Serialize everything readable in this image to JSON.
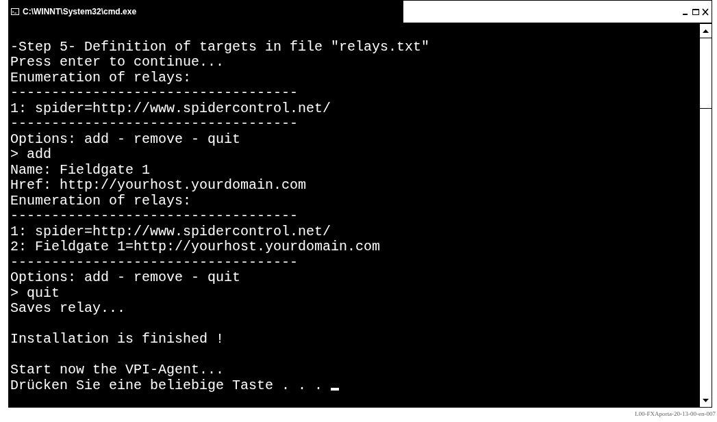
{
  "window": {
    "title": "C:\\WINNT\\System32\\cmd.exe",
    "active": true
  },
  "console_lines": [
    {
      "kind": "blank",
      "cursor": false
    },
    {
      "kind": "text",
      "text": "-Step 5- Definition of targets in file \"relays.txt\"",
      "cursor": false
    },
    {
      "kind": "text",
      "text": "Press enter to continue...",
      "cursor": false
    },
    {
      "kind": "text",
      "text": "Enumeration of relays:",
      "cursor": false
    },
    {
      "kind": "text",
      "text": "-----------------------------------",
      "cursor": false
    },
    {
      "kind": "text",
      "text": "1: spider=http://www.spidercontrol.net/",
      "cursor": false
    },
    {
      "kind": "text",
      "text": "-----------------------------------",
      "cursor": false
    },
    {
      "kind": "text",
      "text": "Options: add - remove - quit",
      "cursor": false
    },
    {
      "kind": "text",
      "text": "> add",
      "cursor": false
    },
    {
      "kind": "text",
      "text": "Name: Fieldgate 1",
      "cursor": false
    },
    {
      "kind": "text",
      "text": "Href: http://yourhost.yourdomain.com",
      "cursor": false
    },
    {
      "kind": "text",
      "text": "Enumeration of relays:",
      "cursor": false
    },
    {
      "kind": "text",
      "text": "-----------------------------------",
      "cursor": false
    },
    {
      "kind": "text",
      "text": "1: spider=http://www.spidercontrol.net/",
      "cursor": false
    },
    {
      "kind": "text",
      "text": "2: Fieldgate 1=http://yourhost.yourdomain.com",
      "cursor": false
    },
    {
      "kind": "text",
      "text": "-----------------------------------",
      "cursor": false
    },
    {
      "kind": "text",
      "text": "Options: add - remove - quit",
      "cursor": false
    },
    {
      "kind": "text",
      "text": "> quit",
      "cursor": false
    },
    {
      "kind": "text",
      "text": "Saves relay...",
      "cursor": false
    },
    {
      "kind": "blank",
      "cursor": false
    },
    {
      "kind": "text",
      "text": "Installation is finished !",
      "cursor": false
    },
    {
      "kind": "blank",
      "cursor": false
    },
    {
      "kind": "text",
      "text": "Start now the VPI-Agent...",
      "cursor": false
    },
    {
      "kind": "text",
      "text": "Drücken Sie eine beliebige Taste . . . ",
      "cursor": true
    }
  ],
  "figure_label": "L00-FXAporta-20-13-00-en-007"
}
